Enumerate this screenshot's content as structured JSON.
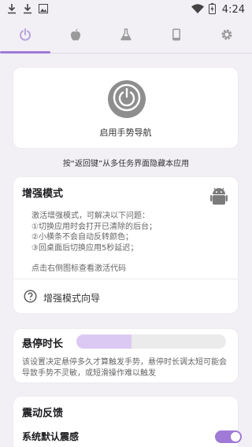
{
  "status_bar": {
    "time": "4:24"
  },
  "tabs": [
    {
      "icon": "power-icon",
      "selected": true
    },
    {
      "icon": "apple-icon",
      "selected": false
    },
    {
      "icon": "flask-icon",
      "selected": false
    },
    {
      "icon": "phone-icon",
      "selected": false
    },
    {
      "icon": "gear-icon",
      "selected": false
    }
  ],
  "power_card": {
    "label": "启用手势导航"
  },
  "hint": "按“返回键”从多任务界面隐藏本应用",
  "enhance": {
    "title": "增强模式",
    "lines": [
      "激活增强模式，可解决以下问题：",
      "①切换应用时会打开已清除的后台；",
      "②小横条不会自动反转颜色；",
      "③回桌面后切换应用5秒延迟；"
    ],
    "activate_hint": "点击右侧图标查看激活代码",
    "guide_label": "增强模式向导"
  },
  "hover": {
    "title": "悬停时长",
    "level": 0.37,
    "desc": "该设置决定悬停多久才算触发手势，悬停时长调太短可能会导致手势不灵敏，或短滑操作难以触发"
  },
  "vibration": {
    "title": "震动反馈",
    "row_label": "系统默认震感",
    "enabled": true
  },
  "colors": {
    "accent": "#a07ad6",
    "slider_fill": "#dcc9f3",
    "background": "#f2eff5"
  }
}
